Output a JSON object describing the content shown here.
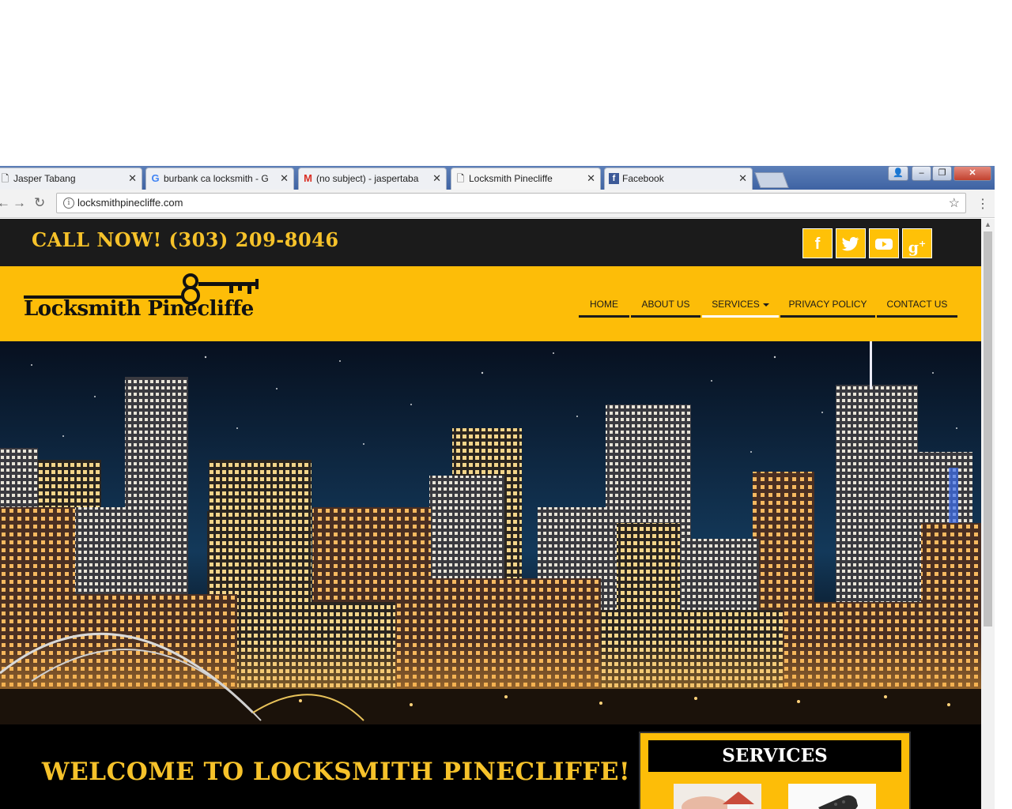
{
  "browser": {
    "tabs": [
      {
        "label": "Jasper Tabang",
        "favicon": "page-icon"
      },
      {
        "label": "burbank ca locksmith - G",
        "favicon": "google-icon"
      },
      {
        "label": "(no subject) - jaspertaba",
        "favicon": "gmail-icon"
      },
      {
        "label": "Locksmith Pinecliffe",
        "favicon": "page-icon",
        "active": true
      },
      {
        "label": "Facebook",
        "favicon": "facebook-icon"
      }
    ],
    "url": "locksmithpinecliffe.com"
  },
  "site": {
    "call_now": "CALL NOW! (303) 209-8046",
    "social": [
      "facebook-icon",
      "twitter-icon",
      "youtube-icon",
      "google-plus-icon"
    ],
    "logo_text": "Locksmith Pinecliffe",
    "nav": [
      {
        "label": "HOME"
      },
      {
        "label": "ABOUT US"
      },
      {
        "label": "SERVICES",
        "active": true,
        "dropdown": true
      },
      {
        "label": "PRIVACY POLICY"
      },
      {
        "label": "CONTACT US"
      }
    ],
    "welcome": "WELCOME TO LOCKSMITH PINECLIFFE!",
    "services_heading": "SERVICES"
  },
  "colors": {
    "accent_yellow": "#fdbd08",
    "title_gold": "#f6c22a",
    "dark_bar": "#1b1b1b",
    "tab_strip_blue": "#4a6cab"
  }
}
